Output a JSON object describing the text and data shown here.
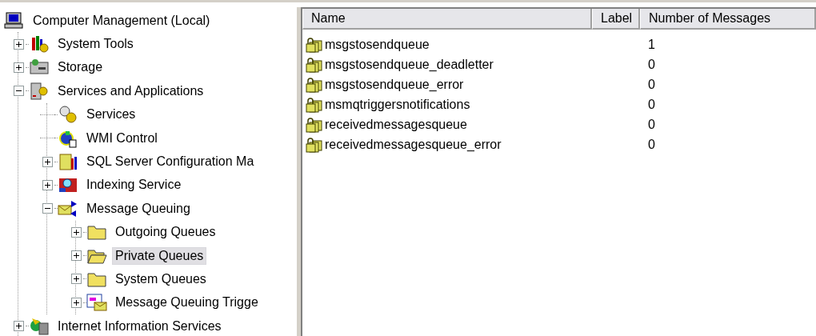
{
  "tree": {
    "label": "Computer Management (Local)",
    "kind": "computer",
    "selected": false,
    "children": [
      {
        "label": "System Tools",
        "kind": "tools",
        "selected": false,
        "expanded": false
      },
      {
        "label": "Storage",
        "kind": "storage",
        "selected": false,
        "expanded": false
      },
      {
        "label": "Services and Applications",
        "kind": "server",
        "selected": false,
        "expanded": true,
        "children": [
          {
            "label": "Services",
            "kind": "gears",
            "selected": false
          },
          {
            "label": "WMI Control",
            "kind": "wmi",
            "selected": false
          },
          {
            "label": "SQL Server Configuration Ma",
            "kind": "sql",
            "selected": false,
            "expanded": false
          },
          {
            "label": "Indexing Service",
            "kind": "indexing",
            "selected": false,
            "expanded": false
          },
          {
            "label": "Message Queuing",
            "kind": "mq",
            "selected": false,
            "expanded": true,
            "children": [
              {
                "label": "Outgoing Queues",
                "kind": "folder",
                "selected": false,
                "expanded": false
              },
              {
                "label": "Private Queues",
                "kind": "folder-open",
                "selected": true,
                "expanded": false
              },
              {
                "label": "System Queues",
                "kind": "folder",
                "selected": false,
                "expanded": false
              },
              {
                "label": "Message Queuing Trigge",
                "kind": "triggers",
                "selected": false,
                "expanded": false
              }
            ]
          }
        ]
      },
      {
        "label": "Internet Information Services",
        "kind": "iis",
        "selected": false,
        "expanded": false
      }
    ]
  },
  "table": {
    "columns": [
      "Name",
      "Label",
      "Number of Messages"
    ],
    "rows": [
      {
        "name": "msgstosendqueue",
        "count": "1"
      },
      {
        "name": "msgstosendqueue_deadletter",
        "count": "0"
      },
      {
        "name": "msgstosendqueue_error",
        "count": "0"
      },
      {
        "name": "msmqtriggersnotifications",
        "count": "0"
      },
      {
        "name": "receivedmessagesqueue",
        "count": "0"
      },
      {
        "name": "receivedmessagesqueue_error",
        "count": "0"
      }
    ]
  }
}
